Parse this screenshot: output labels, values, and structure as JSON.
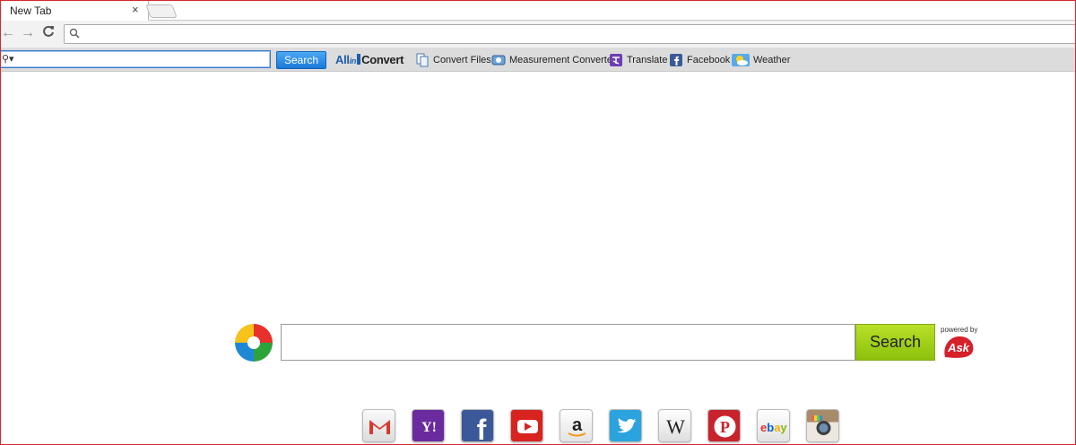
{
  "tab": {
    "title": "New Tab",
    "close": "×"
  },
  "nav": {
    "back": "←",
    "forward": "→",
    "reload": "C"
  },
  "omnibox": {
    "value": ""
  },
  "toolbar": {
    "search_value": "",
    "search_button": "Search",
    "logo": {
      "all": "All",
      "in": "in",
      "convert": "Convert"
    },
    "links": [
      {
        "label": "Convert Files",
        "icon": "convert-files-icon"
      },
      {
        "label": "Measurement Converter",
        "icon": "measurement-icon"
      },
      {
        "label": "Translate",
        "icon": "translate-icon"
      },
      {
        "label": "Facebook",
        "icon": "facebook-icon"
      },
      {
        "label": "Weather",
        "icon": "weather-icon"
      }
    ]
  },
  "search": {
    "value": "",
    "button": "Search",
    "powered_by": "powered by",
    "brand": "Ask"
  },
  "quicklinks": [
    {
      "icon": "gmail-icon",
      "glyph": "M"
    },
    {
      "icon": "yahoo-icon",
      "glyph": "Y!"
    },
    {
      "icon": "facebook-icon",
      "glyph": "f"
    },
    {
      "icon": "youtube-icon",
      "glyph": "▶"
    },
    {
      "icon": "amazon-icon",
      "glyph": "a"
    },
    {
      "icon": "twitter-icon",
      "glyph": "🐦"
    },
    {
      "icon": "wikipedia-icon",
      "glyph": "W"
    },
    {
      "icon": "pinterest-icon",
      "glyph": "P"
    },
    {
      "icon": "ebay-icon",
      "glyph": "ebY"
    },
    {
      "icon": "instagram-icon",
      "glyph": "◉"
    }
  ],
  "colors": {
    "accent_blue": "#1a79d8",
    "search_green": "#8cc10b",
    "ask_red": "#d6202a",
    "frame_red": "#d9262c"
  }
}
